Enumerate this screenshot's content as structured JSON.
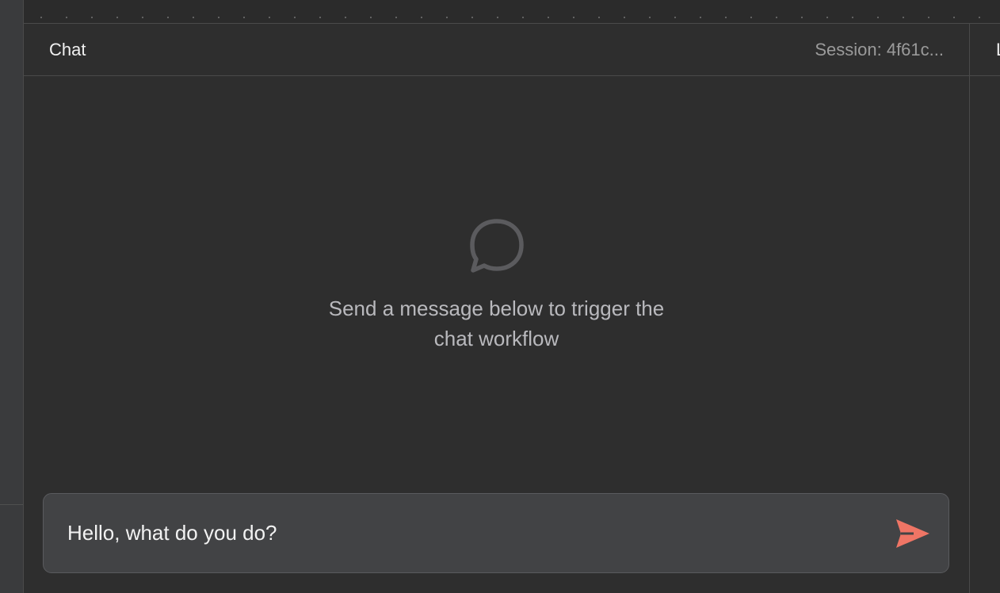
{
  "chat": {
    "title": "Chat",
    "session_label": "Session: 4f61c..."
  },
  "empty_state": {
    "icon": "chat-bubble-icon",
    "message": "Send a message below to trigger the chat workflow"
  },
  "input": {
    "value": "Hello, what do you do?",
    "send_icon": "send-icon"
  },
  "right_panel": {
    "title_visible": "L"
  },
  "colors": {
    "background": "#2e2e2e",
    "input_bg": "#424345",
    "accent": "#ef7565"
  }
}
